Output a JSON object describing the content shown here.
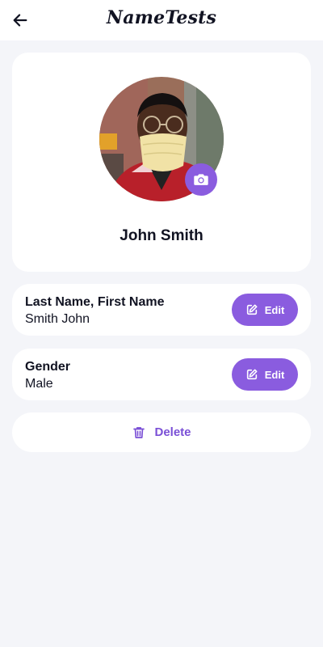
{
  "app_bar": {
    "title": "NameTests",
    "back_icon": "arrow-left-icon"
  },
  "profile": {
    "name": "John Smith",
    "avatar_alt": "profile photo",
    "camera_icon": "camera-icon"
  },
  "fields": [
    {
      "label": "Last Name, First Name",
      "value": "Smith John",
      "edit_label": "Edit"
    },
    {
      "label": "Gender",
      "value": "Male",
      "edit_label": "Edit"
    }
  ],
  "delete": {
    "label": "Delete",
    "icon": "trash-icon"
  },
  "colors": {
    "accent": "#8a5cdf",
    "background": "#f4f5f9",
    "card": "#ffffff",
    "text": "#111322"
  }
}
